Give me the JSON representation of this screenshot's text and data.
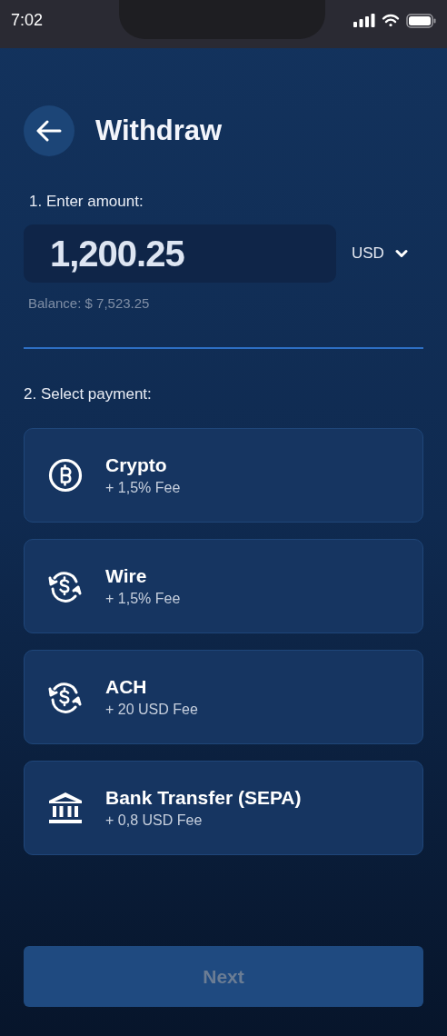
{
  "status_bar": {
    "time": "7:02"
  },
  "header": {
    "title": "Withdraw"
  },
  "amount_section": {
    "label": "1. Enter amount:",
    "amount": "1,200.25",
    "currency": "USD",
    "balance": "Balance: $ 7,523.25"
  },
  "payment_section": {
    "label": "2. Select payment:"
  },
  "methods": [
    {
      "kind": "crypto",
      "name": "Crypto",
      "fee": "+ 1,5% Fee"
    },
    {
      "kind": "exchange",
      "name": "Wire",
      "fee": "+ 1,5% Fee"
    },
    {
      "kind": "exchange",
      "name": "ACH",
      "fee": "+ 20 USD Fee"
    },
    {
      "kind": "bank",
      "name": "Bank Transfer (SEPA)",
      "fee": "+ 0,8 USD Fee"
    }
  ],
  "next_button": {
    "label": "Next",
    "disabled": true
  }
}
